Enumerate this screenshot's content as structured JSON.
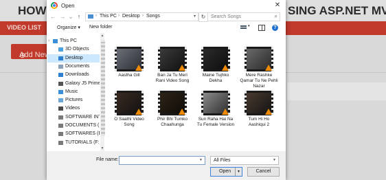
{
  "background": {
    "title_left": "HOW T",
    "title_right": "SING ASP.NET MVC5",
    "bar_label": "VIDEO LIST",
    "add_new_label": "Add New"
  },
  "dialog": {
    "title": "Open",
    "close": "✕",
    "nav": {
      "back": "←",
      "forward": "→",
      "recent": "⌄",
      "up": "↑"
    },
    "breadcrumb": [
      "This PC",
      "Desktop",
      "Songs"
    ],
    "refresh": "↻",
    "search_placeholder": "Search Songs",
    "toolbar": {
      "organize": "Organize ▾",
      "new_folder": "New folder",
      "help": "?"
    },
    "sidebar": [
      {
        "label": "This PC",
        "icon": "computer-icon",
        "color": "#3b8fd9",
        "indent": 0,
        "selected": false
      },
      {
        "label": "3D Objects",
        "icon": "3d-objects-icon",
        "color": "#4aa3df",
        "indent": 1,
        "selected": false
      },
      {
        "label": "Desktop",
        "icon": "desktop-icon",
        "color": "#2f7fd0",
        "indent": 1,
        "selected": true
      },
      {
        "label": "Documents",
        "icon": "documents-icon",
        "color": "#8aa0b8",
        "indent": 1,
        "selected": false
      },
      {
        "label": "Downloads",
        "icon": "downloads-icon",
        "color": "#2f7fd0",
        "indent": 1,
        "selected": false
      },
      {
        "label": "Galaxy J5 Prime",
        "icon": "phone-icon",
        "color": "#555555",
        "indent": 1,
        "selected": false
      },
      {
        "label": "Music",
        "icon": "music-icon",
        "color": "#3b8fd9",
        "indent": 1,
        "selected": false
      },
      {
        "label": "Pictures",
        "icon": "pictures-icon",
        "color": "#6aa7d8",
        "indent": 1,
        "selected": false
      },
      {
        "label": "Videos",
        "icon": "videos-icon",
        "color": "#4a4a4a",
        "indent": 1,
        "selected": false
      },
      {
        "label": "SOFTWARE INTA",
        "icon": "drive-icon",
        "color": "#7a7a7a",
        "indent": 1,
        "selected": false
      },
      {
        "label": "DOCUMENTS (D",
        "icon": "drive-icon",
        "color": "#7a7a7a",
        "indent": 1,
        "selected": false
      },
      {
        "label": "SOFTWARES (E:)",
        "icon": "drive-icon",
        "color": "#7a7a7a",
        "indent": 1,
        "selected": false
      },
      {
        "label": "TUTORIALS (F:)",
        "icon": "drive-icon",
        "color": "#7a7a7a",
        "indent": 1,
        "selected": false
      }
    ],
    "files": [
      {
        "name": "Aastha Gill",
        "colors": [
          "#6b6f77",
          "#2d2f36"
        ]
      },
      {
        "name": "Ban Ja Tu Meri Rani Video Song",
        "colors": [
          "#3a3a3a",
          "#111111"
        ]
      },
      {
        "name": "Maine Tujhko Dekha",
        "colors": [
          "#2b2b2b",
          "#0d0d0d"
        ]
      },
      {
        "name": "Mere Rashke Qamar Tu Ne Pehli Nazar",
        "colors": [
          "#6a6a6a",
          "#2a2a2a"
        ]
      },
      {
        "name": "O Saathi Video Song",
        "colors": [
          "#3a2a22",
          "#111111"
        ]
      },
      {
        "name": "Phir Bhi Tumko Chaahunga",
        "colors": [
          "#2e2418",
          "#0e0b08"
        ]
      },
      {
        "name": "Sun Raha Hai Na Tu Female Version",
        "colors": [
          "#8a8a8a",
          "#303030"
        ]
      },
      {
        "name": "Tum Hi Ho Aashiqui 2",
        "colors": [
          "#4a3a30",
          "#141414"
        ]
      }
    ],
    "file_name_label": "File name:",
    "file_name_value": "",
    "filter_value": "All Files",
    "open_label": "Open",
    "cancel_label": "Cancel"
  }
}
